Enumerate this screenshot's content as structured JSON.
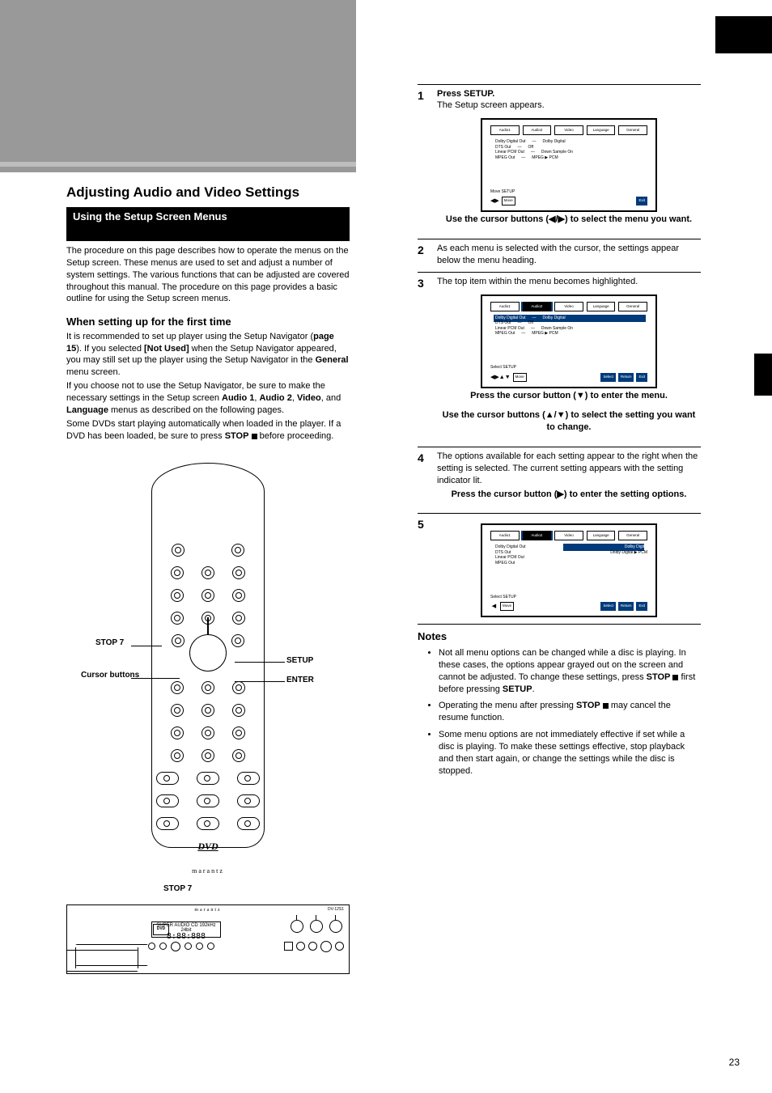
{
  "page_header": {
    "section_title": "Adjusting Audio and Video Settings",
    "subsection_title": "Using the Setup Screen Menus"
  },
  "intro_para": "The procedure on this page describes how to operate the menus on the Setup screen. These menus are used to set and adjust a number of system settings. The various functions that can be adjusted are covered throughout this manual. The procedure on this page provides a basic outline for using the Setup screen menus.",
  "when_heading": "When setting up for the first time",
  "when_para_pre": "It is recommended to set up player using the Setup Navigator (",
  "when_page_ref": "page 15",
  "when_para_mid1": "). If you selected ",
  "when_bold1": "[Not Used]",
  "when_para_mid2": " when the Setup Navigator appeared, you may still set up the player using the Setup Navigator in the ",
  "when_bold2": "General",
  "when_para_mid3": " menu screen.",
  "when_para2_pre": "If you choose not to use the Setup Navigator, be sure to make the necessary settings in the Setup screen",
  "menus_list": [
    "Audio 1",
    "Audio 2",
    "Video",
    "Language"
  ],
  "when_para2_post": " menus as described on the following pages.",
  "when_para3_pre": "Some DVDs start playing automatically when loaded in the player. If a DVD has been loaded, be sure to press ",
  "when_bold3": "STOP",
  "when_para3_post": " before proceeding.",
  "steps": {
    "s1": {
      "num": "1",
      "lead": "Press SETUP.",
      "sub": "The Setup screen appears.",
      "bottom_caption": "Use the cursor buttons (◀/▶) to select the menu you want."
    },
    "s2": {
      "num": "2",
      "sub": "As each menu is selected with the cursor, the settings appear below the menu heading.",
      "bottom_caption": "Press the cursor button (▼) to enter the menu."
    },
    "s3": {
      "num": "3",
      "sub": "The top item within the menu becomes highlighted.",
      "bottom_caption_pre": "Use the cursor buttons (▲/▼) to select the setting you want to change."
    },
    "s4": {
      "num": "4",
      "sub": "The options available for each setting appear to the right when the setting is selected. The current setting appears with the setting indicator lit.",
      "bottom_caption": "Press the cursor button (▶) to enter the setting options."
    },
    "s5": {
      "num": "5"
    }
  },
  "osd": {
    "tabs": [
      "Audio1",
      "Audio2",
      "Video",
      "Language",
      "General"
    ],
    "a2_items": [
      [
        "Dolby Digital Out",
        "Dolby Digital"
      ],
      [
        "DTS Out",
        "Off"
      ],
      [
        "Linear PCM Out",
        "Down Sample On"
      ],
      [
        "MPEG Out",
        "MPEG ▶ PCM"
      ]
    ],
    "dd_options": [
      "Dolby Digital",
      "Dolby Digital ▶ PCM"
    ],
    "hint_select": "Move         SETUP",
    "hint_setup": "Select         SETUP",
    "bottom_move": "Move",
    "bottom_exit": "Exit",
    "bottom_select": "Select",
    "bottom_return": "Return"
  },
  "notes_heading": "Notes",
  "notes": [
    {
      "pre": "Not all menu options can be changed while a disc is playing. In these cases, the options appear grayed out on the screen and cannot be adjusted. To change these settings, press ",
      "b1": "STOP",
      "mid": " first before pressing ",
      "b2": "SETUP",
      "post": "."
    },
    {
      "pre": "Operating the menu after pressing ",
      "b1": "STOP",
      "post": " may cancel the resume function."
    },
    {
      "pre": "Some menu options are not immediately effective if set while a disc is playing. To make these settings effective, stop playback and then start again, or change the settings while the disc is stopped."
    }
  ],
  "remote": {
    "callouts": {
      "stop": "STOP 7",
      "setup": "SETUP",
      "cursor": "Cursor buttons",
      "enter": "ENTER"
    },
    "dvd_label": "DVD",
    "brand": "marantz"
  },
  "front_panel": {
    "brand": "marantz",
    "model": "DV-12S1",
    "dvd_badge": "DVD",
    "disp_top": "SUPER AUDIO CD     192kHz   24bit",
    "disp_bot": "8:88:888",
    "callouts": {
      "stop": "STOP 7"
    }
  },
  "page_number": "23",
  "glyphs": {
    "lrtri": "◀/▶",
    "down": "▼",
    "updown": "▲/▼",
    "right": "▶",
    "stop_square": "■"
  }
}
